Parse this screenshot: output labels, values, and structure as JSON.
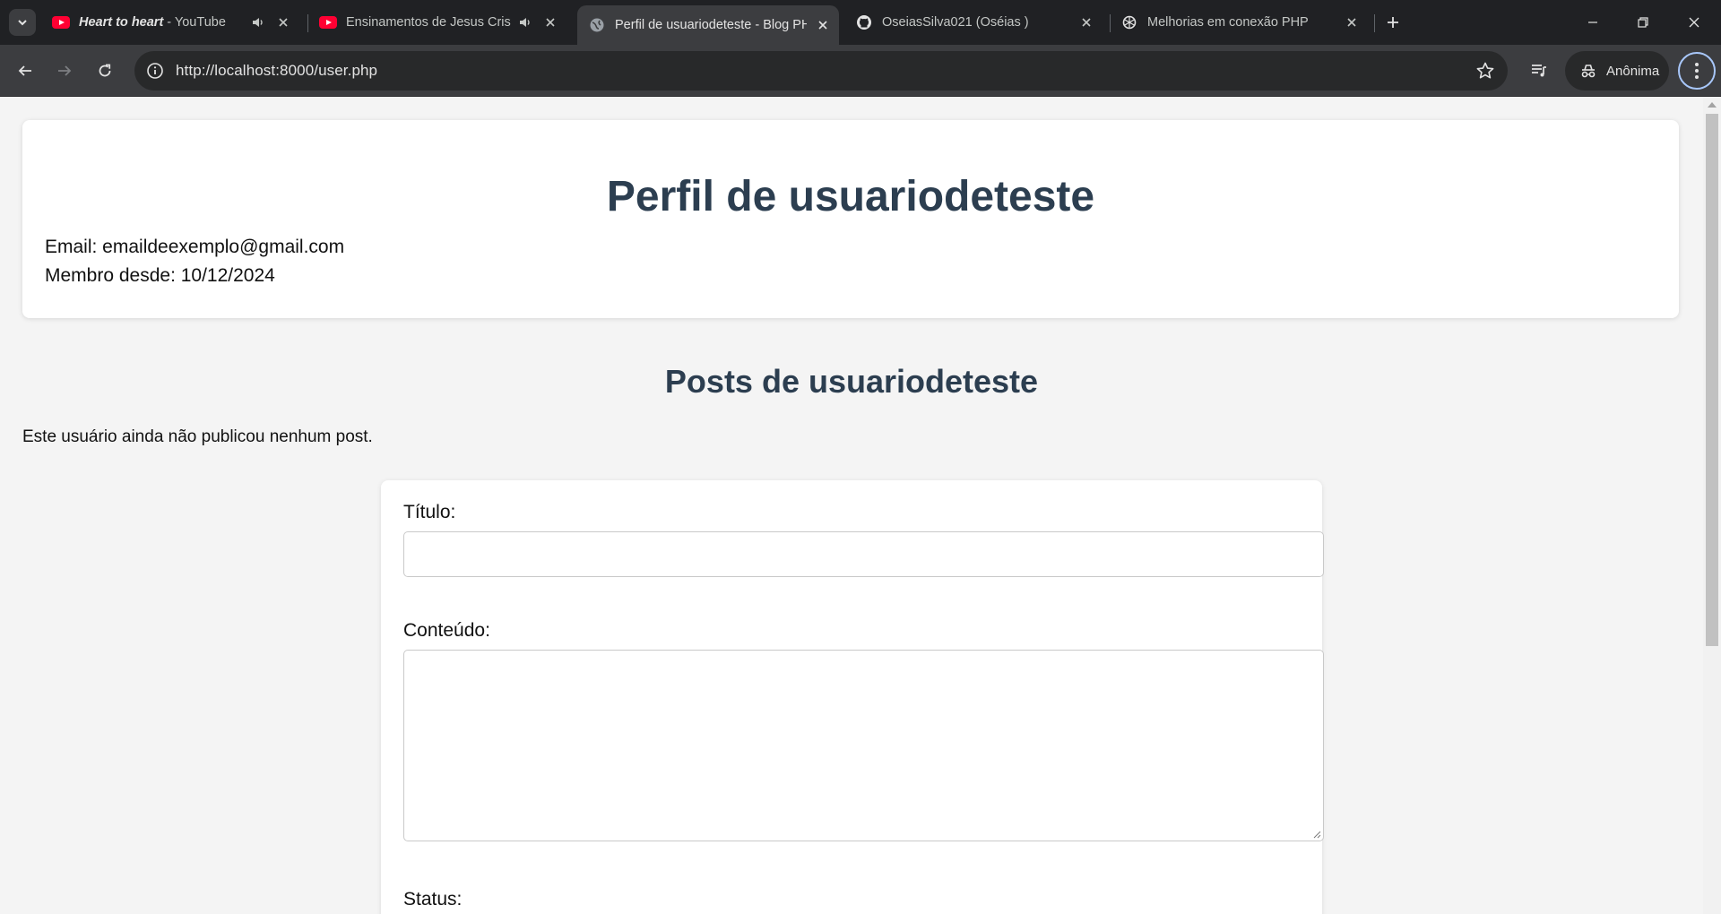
{
  "browser": {
    "tabs": [
      {
        "title_bold": "Heart to heart",
        "title_rest": " - YouTube",
        "favicon": "youtube-icon",
        "audio": true
      },
      {
        "title": "Ensinamentos de Jesus Cristo",
        "favicon": "youtube-icon",
        "audio": true
      },
      {
        "title": "Perfil de usuariodeteste - Blog PHP",
        "favicon": "globe-icon",
        "active": true
      },
      {
        "title": "OseiasSilva021 (Oséias )",
        "favicon": "github-icon"
      },
      {
        "title": "Melhorias em conexão PHP",
        "favicon": "chatgpt-icon"
      }
    ],
    "url": "http://localhost:8000/user.php",
    "incognito_label": "Anônima"
  },
  "profile": {
    "title": "Perfil de usuariodeteste",
    "email_line": "Email: emaildeexemplo@gmail.com",
    "member_line": "Membro desde: 10/12/2024"
  },
  "posts": {
    "title": "Posts de usuariodeteste",
    "empty_message": "Este usuário ainda não publicou nenhum post."
  },
  "form": {
    "title_label": "Título:",
    "title_value": "",
    "content_label": "Conteúdo:",
    "content_value": "",
    "status_label": "Status:"
  },
  "colors": {
    "heading": "#2c3e50",
    "page_bg": "#f4f4f4",
    "chrome_dark": "#202124",
    "chrome_toolbar": "#3c3d40"
  }
}
